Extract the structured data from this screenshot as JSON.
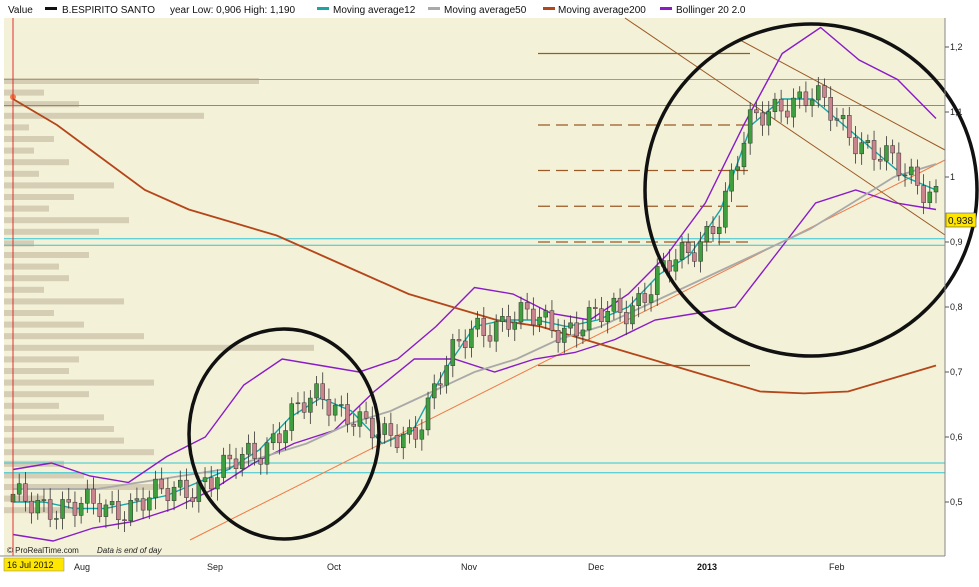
{
  "legend": {
    "value_label": "Value",
    "instrument": "B.ESPIRITO SANTO",
    "year_range": "year Low: 0,906 High: 1,190",
    "ma12": "Moving average12",
    "ma50": "Moving average50",
    "ma200": "Moving average200",
    "bollinger": "Bollinger 20 2.0"
  },
  "footer": {
    "source": "© ProRealTime.com",
    "note": "Data is end of day",
    "start_date": "16 Jul 2012"
  },
  "price_label": "0,938",
  "colors": {
    "background": "#f3f1d7",
    "up_candle": "#3f9f3f",
    "down_candle": "#c9848d",
    "ma12": "#17a5a5",
    "ma50": "#a9a9a9",
    "ma200": "#b4461a",
    "bollinger": "#8a1bc7",
    "circle": "#111111",
    "volume_profile": "#cfc7ae"
  },
  "chart_data": {
    "type": "candlestick",
    "title": "B.ESPIRITO SANTO",
    "x_ticks": [
      "Aug",
      "Sep",
      "Oct",
      "Nov",
      "Dec",
      "2013",
      "Feb"
    ],
    "y_ticks": [
      "0,5",
      "0,6",
      "0,7",
      "0,8",
      "0,9",
      "1",
      "1,1",
      "1,2"
    ],
    "y_tick_values": [
      0.5,
      0.6,
      0.7,
      0.8,
      0.9,
      1.0,
      1.1,
      1.2
    ],
    "ylim": [
      0.44,
      1.26
    ],
    "year_low": 0.906,
    "year_high": 1.19,
    "last_price": 0.938,
    "candles_sample": [
      {
        "date": "Aug",
        "close": 0.5
      },
      {
        "date": "Sep",
        "close": 0.56
      },
      {
        "date": "Oct",
        "close": 0.67
      },
      {
        "date": "Nov",
        "close": 0.78
      },
      {
        "date": "Dec",
        "close": 0.79
      },
      {
        "date": "2013",
        "close": 0.9
      },
      {
        "date": "Feb",
        "close": 1.05
      }
    ],
    "ma12": [
      0.5,
      0.5,
      0.49,
      0.49,
      0.5,
      0.51,
      0.53,
      0.55,
      0.58,
      0.63,
      0.66,
      0.64,
      0.59,
      0.61,
      0.7,
      0.77,
      0.78,
      0.78,
      0.77,
      0.78,
      0.8,
      0.85,
      0.88,
      0.95,
      1.08,
      1.12,
      1.12,
      1.08,
      1.04,
      1.0,
      0.98
    ],
    "ma50": [
      0.52,
      0.52,
      0.52,
      0.53,
      0.54,
      0.55,
      0.57,
      0.59,
      0.62,
      0.64,
      0.67,
      0.7,
      0.72,
      0.75,
      0.77,
      0.8,
      0.83,
      0.86,
      0.89,
      0.92,
      0.96,
      1.0,
      1.02
    ],
    "ma200": [
      1.12,
      1.08,
      1.03,
      0.98,
      0.95,
      0.93,
      0.91,
      0.88,
      0.85,
      0.82,
      0.8,
      0.78,
      0.77,
      0.75,
      0.73,
      0.71,
      0.69,
      0.67,
      0.667,
      0.67,
      0.69,
      0.71
    ],
    "bollinger_upper": [
      0.55,
      0.56,
      0.54,
      0.53,
      0.57,
      0.6,
      0.68,
      0.72,
      0.71,
      0.7,
      0.72,
      0.77,
      0.83,
      0.82,
      0.79,
      0.78,
      0.82,
      0.88,
      0.96,
      1.08,
      1.19,
      1.23,
      1.18,
      1.15,
      1.09
    ],
    "bollinger_lower": [
      0.45,
      0.44,
      0.46,
      0.47,
      0.49,
      0.52,
      0.56,
      0.59,
      0.61,
      0.67,
      0.72,
      0.72,
      0.7,
      0.72,
      0.73,
      0.75,
      0.78,
      0.79,
      0.8,
      0.88,
      0.96,
      0.98,
      0.96,
      0.95
    ],
    "horizontal_levels": [
      1.15,
      1.11,
      0.905,
      0.56,
      0.545
    ],
    "markers": [
      "16 Jul 2012"
    ]
  }
}
